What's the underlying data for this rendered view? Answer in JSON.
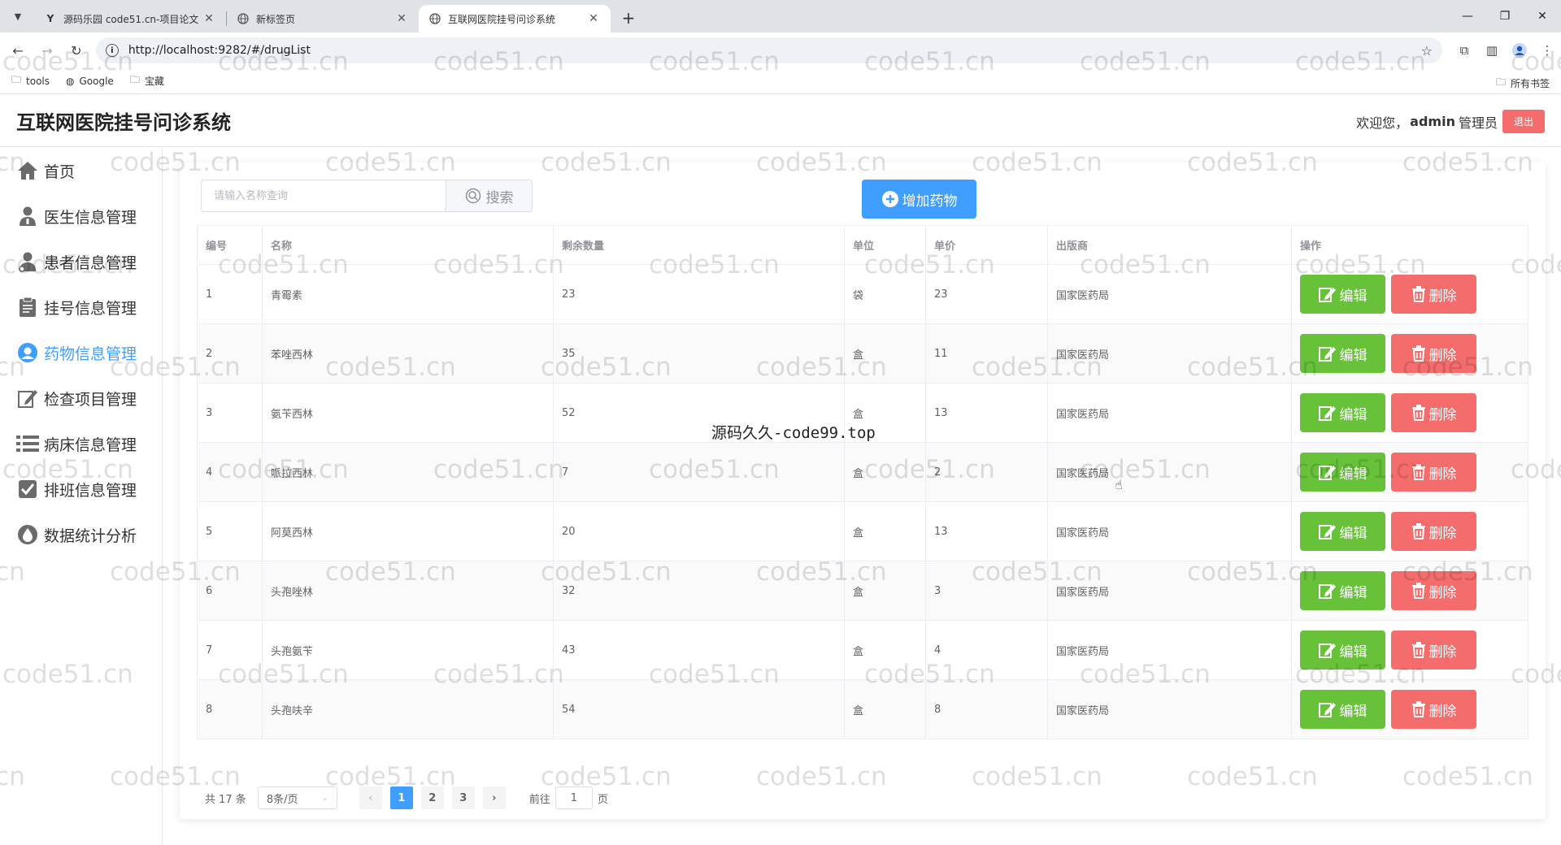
{
  "browser": {
    "tabs": [
      {
        "title": "源码乐园 code51.cn-项目论文",
        "favicon": "Y"
      },
      {
        "title": "新标签页",
        "favicon": "globe"
      },
      {
        "title": "互联网医院挂号问诊系统",
        "favicon": "globe"
      }
    ],
    "url": "http://localhost:9282/#/drugList",
    "bookmarks": [
      "tools",
      "Google",
      "宝藏"
    ],
    "bookmarks_right": "所有书签"
  },
  "header": {
    "title": "互联网医院挂号问诊系统",
    "welcome": "欢迎您，",
    "user": "admin",
    "role": "管理员",
    "logout": "退出"
  },
  "sidebar": {
    "items": [
      {
        "label": "首页",
        "icon": "home-icon"
      },
      {
        "label": "医生信息管理",
        "icon": "doctor-icon"
      },
      {
        "label": "患者信息管理",
        "icon": "patient-icon"
      },
      {
        "label": "挂号信息管理",
        "icon": "clipboard-icon"
      },
      {
        "label": "药物信息管理",
        "icon": "drug-icon",
        "active": true
      },
      {
        "label": "检查项目管理",
        "icon": "edit-icon"
      },
      {
        "label": "病床信息管理",
        "icon": "list-icon"
      },
      {
        "label": "排班信息管理",
        "icon": "checkbox-icon"
      },
      {
        "label": "数据统计分析",
        "icon": "drop-icon"
      }
    ]
  },
  "toolbar": {
    "search_placeholder": "请输入名称查询",
    "search_label": "搜索",
    "add_label": "增加药物"
  },
  "table": {
    "columns": [
      "编号",
      "名称",
      "剩余数量",
      "单位",
      "单价",
      "出版商",
      "操作"
    ],
    "rows": [
      [
        "1",
        "青霉素",
        "23",
        "袋",
        "23",
        "国家医药局"
      ],
      [
        "2",
        "苯唑西林",
        "35",
        "盒",
        "11",
        "国家医药局"
      ],
      [
        "3",
        "氨苄西林",
        "52",
        "盒",
        "13",
        "国家医药局"
      ],
      [
        "4",
        "哌拉西林",
        "7",
        "盒",
        "2",
        "国家医药局"
      ],
      [
        "5",
        "阿莫西林",
        "20",
        "盒",
        "13",
        "国家医药局"
      ],
      [
        "6",
        "头孢唑林",
        "32",
        "盒",
        "3",
        "国家医药局"
      ],
      [
        "7",
        "头孢氨苄",
        "43",
        "盒",
        "4",
        "国家医药局"
      ],
      [
        "8",
        "头孢呋辛",
        "54",
        "盒",
        "8",
        "国家医药局"
      ]
    ],
    "edit_label": "编辑",
    "delete_label": "删除"
  },
  "pagination": {
    "total": "共 17 条",
    "page_size": "8条/页",
    "pages": [
      "1",
      "2",
      "3"
    ],
    "current": "1",
    "goto_prefix": "前往",
    "goto_value": "1",
    "goto_suffix": "页"
  },
  "overlay": {
    "center_text": "源码久久-code99.top",
    "watermark": "code51.cn"
  },
  "colors": {
    "primary": "#409eff",
    "success": "#67c23a",
    "danger": "#f56c6c"
  }
}
